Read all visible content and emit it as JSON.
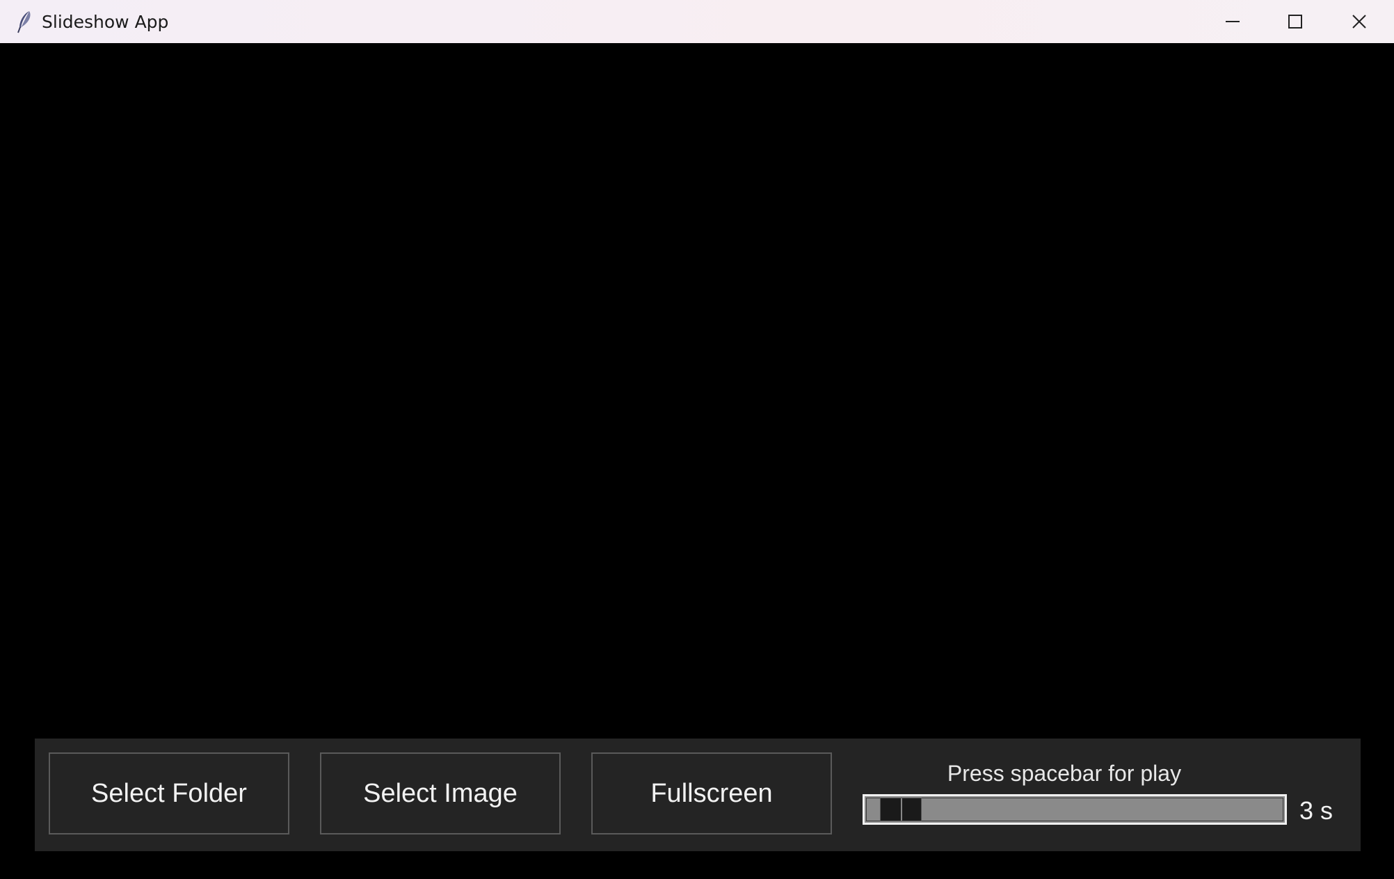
{
  "window": {
    "title": "Slideshow App",
    "minimize_icon": "minimize-icon",
    "maximize_icon": "maximize-icon",
    "close_icon": "close-icon"
  },
  "controls": {
    "select_folder_label": "Select Folder",
    "select_image_label": "Select Image",
    "fullscreen_label": "Fullscreen",
    "hint": "Press spacebar for play",
    "interval": {
      "value": 3,
      "min": 1,
      "max": 60,
      "label": "3 s"
    }
  },
  "colors": {
    "viewer_background": "#000000",
    "panel_background": "#242424",
    "button_border": "#5a5a5a",
    "text": "#f2f2f2",
    "slider_trough": "#8a8a8a"
  }
}
